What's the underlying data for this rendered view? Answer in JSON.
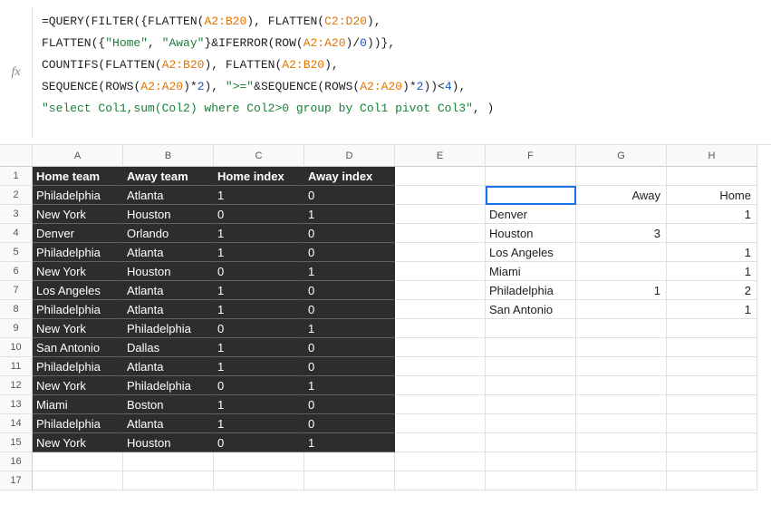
{
  "fx_label": "fx",
  "formula": {
    "line1": [
      {
        "t": "=QUERY",
        "c": "tok-black"
      },
      {
        "t": "(",
        "c": "tok-paren"
      },
      {
        "t": "FILTER",
        "c": "tok-black"
      },
      {
        "t": "({",
        "c": "tok-paren"
      },
      {
        "t": "FLATTEN",
        "c": "tok-black"
      },
      {
        "t": "(",
        "c": "tok-paren"
      },
      {
        "t": "A2:B20",
        "c": "tok-orange"
      },
      {
        "t": "), ",
        "c": "tok-paren"
      },
      {
        "t": "FLATTEN",
        "c": "tok-black"
      },
      {
        "t": "(",
        "c": "tok-paren"
      },
      {
        "t": "C2:D20",
        "c": "tok-orange"
      },
      {
        "t": "),",
        "c": "tok-paren"
      }
    ],
    "line2": [
      {
        "t": "FLATTEN",
        "c": "tok-black"
      },
      {
        "t": "({",
        "c": "tok-paren"
      },
      {
        "t": "\"Home\"",
        "c": "tok-green"
      },
      {
        "t": ", ",
        "c": "tok-paren"
      },
      {
        "t": "\"Away\"",
        "c": "tok-green"
      },
      {
        "t": "}&",
        "c": "tok-paren"
      },
      {
        "t": "IFERROR",
        "c": "tok-black"
      },
      {
        "t": "(",
        "c": "tok-paren"
      },
      {
        "t": "ROW",
        "c": "tok-black"
      },
      {
        "t": "(",
        "c": "tok-paren"
      },
      {
        "t": "A2:A20",
        "c": "tok-orange"
      },
      {
        "t": ")/",
        "c": "tok-paren"
      },
      {
        "t": "0",
        "c": "tok-blue"
      },
      {
        "t": "))},",
        "c": "tok-paren"
      }
    ],
    "line3": [
      {
        "t": "COUNTIFS",
        "c": "tok-black"
      },
      {
        "t": "(",
        "c": "tok-paren"
      },
      {
        "t": "FLATTEN",
        "c": "tok-black"
      },
      {
        "t": "(",
        "c": "tok-paren"
      },
      {
        "t": "A2:B20",
        "c": "tok-orange"
      },
      {
        "t": "), ",
        "c": "tok-paren"
      },
      {
        "t": "FLATTEN",
        "c": "tok-black"
      },
      {
        "t": "(",
        "c": "tok-paren"
      },
      {
        "t": "A2:B20",
        "c": "tok-orange"
      },
      {
        "t": "),",
        "c": "tok-paren"
      }
    ],
    "line4": [
      {
        "t": "SEQUENCE",
        "c": "tok-black"
      },
      {
        "t": "(",
        "c": "tok-paren"
      },
      {
        "t": "ROWS",
        "c": "tok-black"
      },
      {
        "t": "(",
        "c": "tok-paren"
      },
      {
        "t": "A2:A20",
        "c": "tok-orange"
      },
      {
        "t": ")*",
        "c": "tok-paren"
      },
      {
        "t": "2",
        "c": "tok-blue"
      },
      {
        "t": "), ",
        "c": "tok-paren"
      },
      {
        "t": "\">=\"",
        "c": "tok-green"
      },
      {
        "t": "&",
        "c": "tok-paren"
      },
      {
        "t": "SEQUENCE",
        "c": "tok-black"
      },
      {
        "t": "(",
        "c": "tok-paren"
      },
      {
        "t": "ROWS",
        "c": "tok-black"
      },
      {
        "t": "(",
        "c": "tok-paren"
      },
      {
        "t": "A2:A20",
        "c": "tok-orange"
      },
      {
        "t": ")*",
        "c": "tok-paren"
      },
      {
        "t": "2",
        "c": "tok-blue"
      },
      {
        "t": "))<",
        "c": "tok-paren"
      },
      {
        "t": "4",
        "c": "tok-blue"
      },
      {
        "t": "),",
        "c": "tok-paren"
      }
    ],
    "line5": [
      {
        "t": "\"select Col1,sum(Col2) where Col2>0 group by Col1 pivot Col3\"",
        "c": "tok-green"
      },
      {
        "t": ", )",
        "c": "tok-paren"
      }
    ]
  },
  "columns": [
    "A",
    "B",
    "C",
    "D",
    "E",
    "F",
    "G",
    "H"
  ],
  "rowNumbers": [
    "1",
    "2",
    "3",
    "4",
    "5",
    "6",
    "7",
    "8",
    "9",
    "10",
    "11",
    "12",
    "13",
    "14",
    "15",
    "16",
    "17"
  ],
  "darkTable": {
    "headers": {
      "A": "Home team",
      "B": "Away team",
      "C": "Home index",
      "D": "Away index"
    },
    "rows": [
      {
        "A": "Philadelphia",
        "B": "Atlanta",
        "C": "1",
        "D": "0"
      },
      {
        "A": "New York",
        "B": "Houston",
        "C": "0",
        "D": "1"
      },
      {
        "A": "Denver",
        "B": "Orlando",
        "C": "1",
        "D": "0"
      },
      {
        "A": "Philadelphia",
        "B": "Atlanta",
        "C": "1",
        "D": "0"
      },
      {
        "A": "New York",
        "B": "Houston",
        "C": "0",
        "D": "1"
      },
      {
        "A": "Los Angeles",
        "B": "Atlanta",
        "C": "1",
        "D": "0"
      },
      {
        "A": "Philadelphia",
        "B": "Atlanta",
        "C": "1",
        "D": "0"
      },
      {
        "A": "New York",
        "B": "Philadelphia",
        "C": "0",
        "D": "1"
      },
      {
        "A": "San Antonio",
        "B": "Dallas",
        "C": "1",
        "D": "0"
      },
      {
        "A": "Philadelphia",
        "B": "Atlanta",
        "C": "1",
        "D": "0"
      },
      {
        "A": "New York",
        "B": "Philadelphia",
        "C": "0",
        "D": "1"
      },
      {
        "A": "Miami",
        "B": "Boston",
        "C": "1",
        "D": "0"
      },
      {
        "A": "Philadelphia",
        "B": "Atlanta",
        "C": "1",
        "D": "0"
      },
      {
        "A": "New York",
        "B": "Houston",
        "C": "0",
        "D": "1"
      }
    ]
  },
  "queryResult": {
    "headerRow": {
      "F": "",
      "G": "Away",
      "H": "Home"
    },
    "rows": [
      {
        "F": "Denver",
        "G": "",
        "H": "1"
      },
      {
        "F": "Houston",
        "G": "3",
        "H": ""
      },
      {
        "F": "Los Angeles",
        "G": "",
        "H": "1"
      },
      {
        "F": "Miami",
        "G": "",
        "H": "1"
      },
      {
        "F": "Philadelphia",
        "G": "1",
        "H": "2"
      },
      {
        "F": "San Antonio",
        "G": "",
        "H": "1"
      }
    ]
  }
}
